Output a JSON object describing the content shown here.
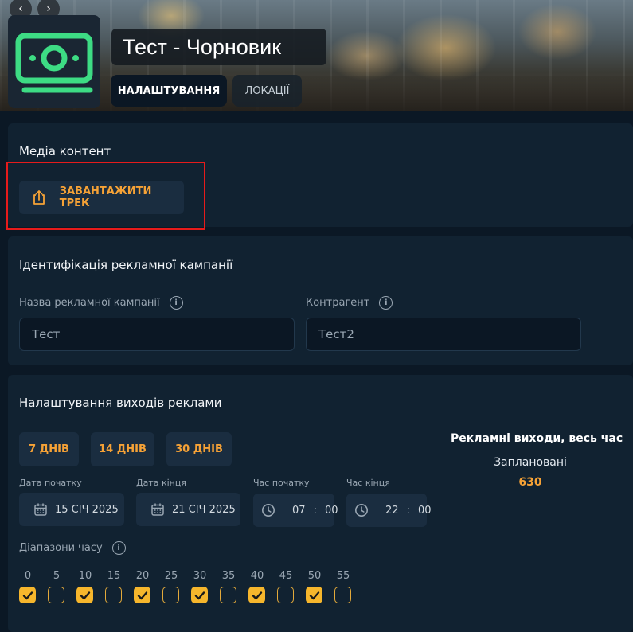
{
  "header": {
    "title": "Тест - Чорновик",
    "tabs": [
      {
        "label": "НАЛАШТУВАННЯ",
        "active": true
      },
      {
        "label": "ЛОКАЦІЇ",
        "active": false
      }
    ],
    "logo_icon": "money-bill-icon",
    "logo_color": "#3ddc84"
  },
  "media": {
    "title": "Медіа контент",
    "upload_label": "ЗАВАНТАЖИТИ ТРЕК",
    "upload_icon": "upload-icon"
  },
  "identification": {
    "title": "Ідентифікація рекламної кампанії",
    "campaign_name_label": "Назва рекламної кампанії",
    "campaign_name_value": "Тест",
    "counterparty_label": "Контрагент",
    "counterparty_value": "Тест2"
  },
  "outputs": {
    "title": "Налаштування виходів реклами",
    "day_buttons": [
      "7 ДНІВ",
      "14 ДНІВ",
      "30 ДНІВ"
    ],
    "start_date_label": "Дата початку",
    "start_date": "15 СІЧ 2025",
    "end_date_label": "Дата кінця",
    "end_date": "21 СІЧ 2025",
    "start_time_label": "Час початку",
    "start_time": {
      "hh": "07",
      "mm": "00"
    },
    "end_time_label": "Час кінця",
    "end_time": {
      "hh": "22",
      "mm": "00"
    },
    "time_ranges_label": "Діапазони часу",
    "time_slots": [
      {
        "minute": "0",
        "checked": true
      },
      {
        "minute": "5",
        "checked": false
      },
      {
        "minute": "10",
        "checked": true
      },
      {
        "minute": "15",
        "checked": false
      },
      {
        "minute": "20",
        "checked": true
      },
      {
        "minute": "25",
        "checked": false
      },
      {
        "minute": "30",
        "checked": true
      },
      {
        "minute": "35",
        "checked": false
      },
      {
        "minute": "40",
        "checked": true
      },
      {
        "minute": "45",
        "checked": false
      },
      {
        "minute": "50",
        "checked": true
      },
      {
        "minute": "55",
        "checked": false
      }
    ]
  },
  "stats": {
    "title": "Рекламні виходи, весь час",
    "planned_label": "Заплановані",
    "planned_value": "630"
  },
  "colors": {
    "accent": "#f6a236",
    "background": "#0b1825",
    "panel": "#112231",
    "highlight": "#e61b1b"
  }
}
